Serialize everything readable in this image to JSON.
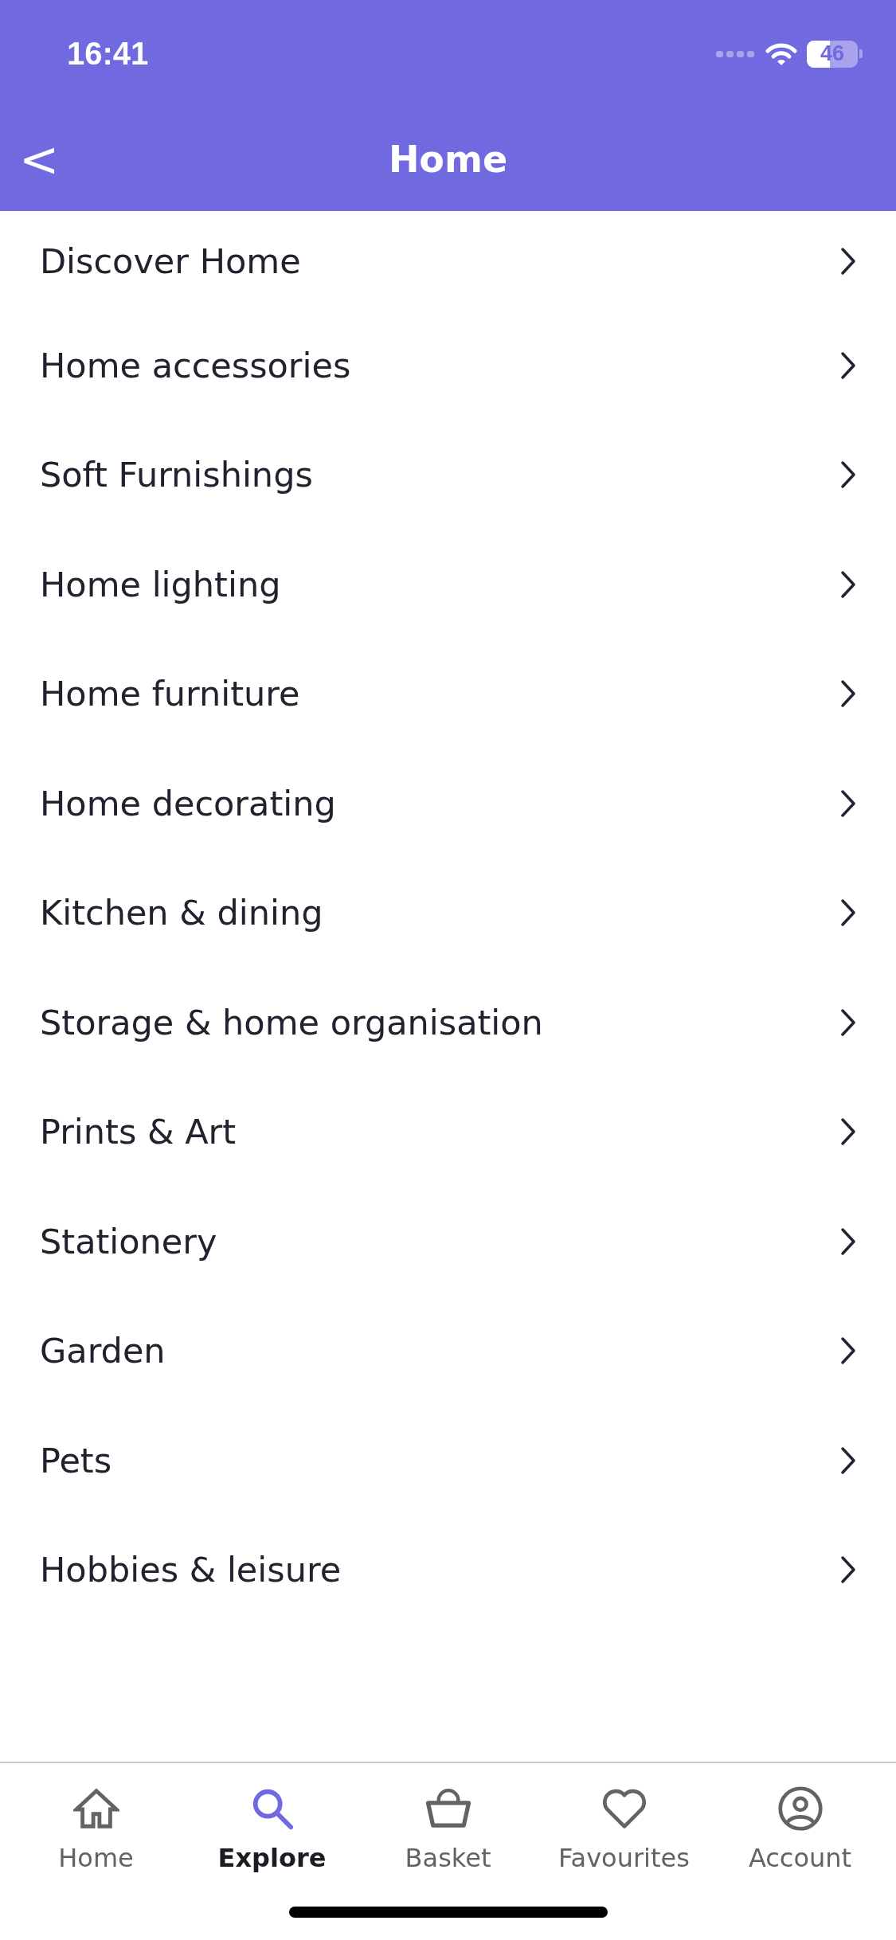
{
  "status_bar": {
    "time": "16:41",
    "battery": "46"
  },
  "header": {
    "back": "<",
    "title": "Home"
  },
  "categories": [
    {
      "label": "Discover Home"
    },
    {
      "label": "Home accessories"
    },
    {
      "label": "Soft Furnishings"
    },
    {
      "label": "Home lighting"
    },
    {
      "label": "Home furniture"
    },
    {
      "label": "Home decorating"
    },
    {
      "label": "Kitchen & dining"
    },
    {
      "label": "Storage & home organisation"
    },
    {
      "label": "Prints & Art"
    },
    {
      "label": "Stationery"
    },
    {
      "label": "Garden"
    },
    {
      "label": "Pets"
    },
    {
      "label": "Hobbies & leisure"
    }
  ],
  "tab_bar": [
    {
      "label": "Home",
      "selected": false
    },
    {
      "label": "Explore",
      "selected": true
    },
    {
      "label": "Basket",
      "selected": false
    },
    {
      "label": "Favourites",
      "selected": false
    },
    {
      "label": "Account",
      "selected": false
    }
  ]
}
